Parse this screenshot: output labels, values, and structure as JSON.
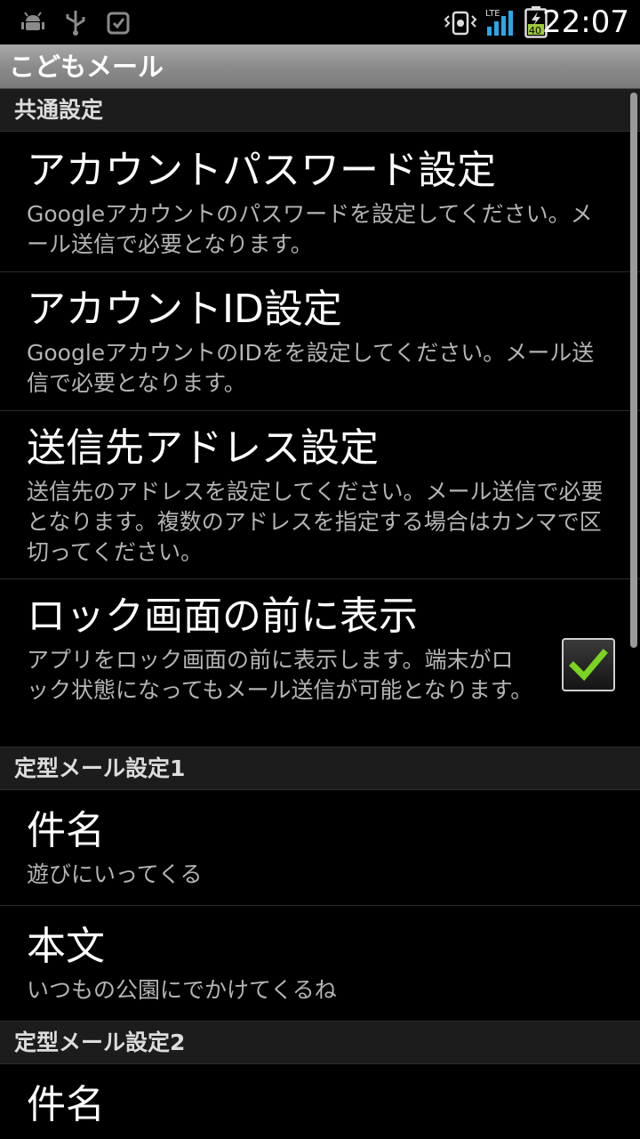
{
  "status_bar": {
    "time": "22:07",
    "network_label": "LTE",
    "battery_level": "40",
    "icons": [
      "android-debug-icon",
      "usb-icon",
      "alarm-icon",
      "vibrate-icon",
      "lte-signal-icon",
      "battery-icon"
    ]
  },
  "app": {
    "title": "こどもメール"
  },
  "sections": {
    "common": {
      "header": "共通設定",
      "account_password": {
        "title": "アカウントパスワード設定",
        "summary": "Googleアカウントのパスワードを設定してください。メール送信で必要となります。"
      },
      "account_id": {
        "title": "アカウントID設定",
        "summary": "GoogleアカウントのIDをを設定してください。メール送信で必要となります。"
      },
      "destination": {
        "title": "送信先アドレス設定",
        "summary": "送信先のアドレスを設定してください。メール送信で必要となります。複数のアドレスを指定する場合はカンマで区切ってください。"
      },
      "lockscreen": {
        "title": "ロック画面の前に表示",
        "summary": "アプリをロック画面の前に表示します。端末がロック状態になってもメール送信が可能となります。",
        "checked": true
      }
    },
    "template1": {
      "header": "定型メール設定1",
      "subject": {
        "title": "件名",
        "summary": "遊びにいってくる"
      },
      "body": {
        "title": "本文",
        "summary": "いつもの公園にでかけてくるね"
      }
    },
    "template2": {
      "header": "定型メール設定2",
      "subject": {
        "title": "件名"
      }
    }
  },
  "colors": {
    "check": "#7dd321",
    "category_bg": "#1c1c1c",
    "titlebar": "#8c8c8c"
  }
}
